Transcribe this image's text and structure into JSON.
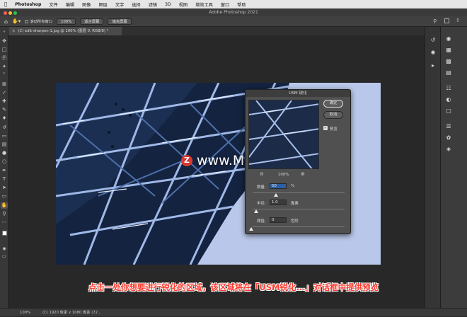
{
  "menubar": {
    "apple_icon": "apple-icon",
    "app_name": "Photoshop",
    "items": [
      "文件",
      "编辑",
      "图像",
      "图层",
      "文字",
      "选择",
      "滤镜",
      "3D",
      "视图",
      "增效工具",
      "窗口",
      "帮助"
    ]
  },
  "window": {
    "title": "Adobe Photoshop 2021"
  },
  "options_bar": {
    "scroll_all_windows": "滚动所有窗口",
    "zoom_100": "100%",
    "fit_screen": "适合屏幕",
    "fill_screen": "填充屏幕"
  },
  "document_tab": {
    "title": "(C) edit-sharpen-1.jpg @ 100% (图层 0, RGB/8) *"
  },
  "dialog": {
    "title": "USM 锐化",
    "ok": "确定",
    "cancel": "取消",
    "preview_label": "预览",
    "preview_checked": true,
    "zoom_level": "100%",
    "amount_label": "数量:",
    "amount_value": "50",
    "amount_unit": "%",
    "radius_label": "半径:",
    "radius_value": "1.0",
    "radius_unit": "像素",
    "threshold_label": "阈值:",
    "threshold_value": "0",
    "threshold_unit": "色阶"
  },
  "watermark": {
    "logo": "Z",
    "text": "www.MacZ.com"
  },
  "caption": {
    "text": "点击一处你想要进行锐化的区域，该区域将在「USM锐化...」对话框中提供预览"
  },
  "status": {
    "zoom": "100%",
    "info": "(C) 1920 像素 x 1080 像素 (72..."
  },
  "colors": {
    "accent_red": "#ff3b2f",
    "dialog_bg": "#505050",
    "app_bg": "#282828"
  }
}
